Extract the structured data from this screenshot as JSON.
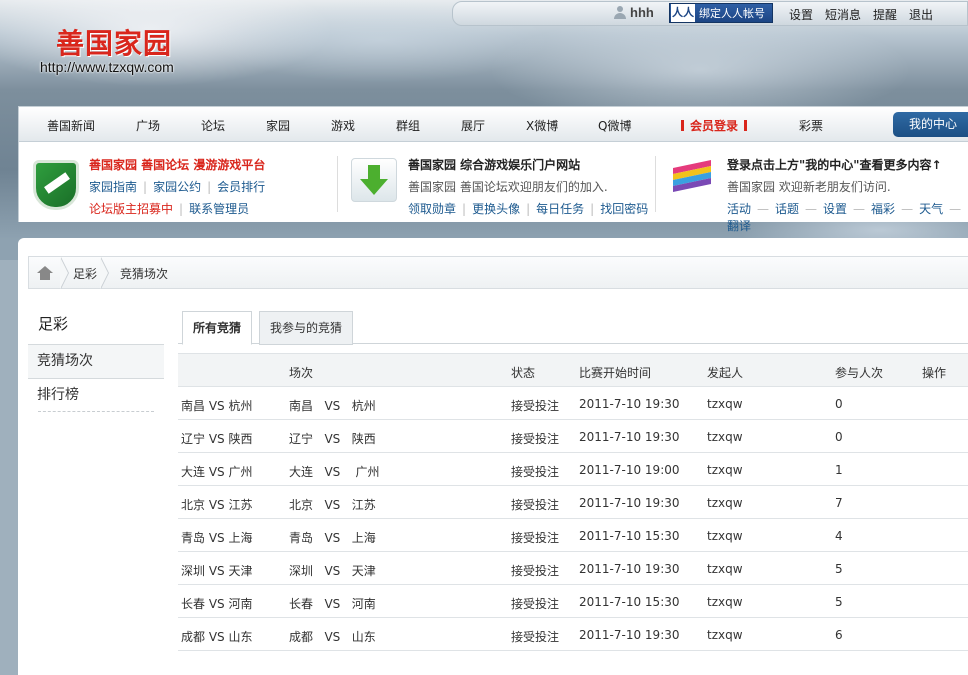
{
  "topbar": {
    "username": "hhh",
    "renren_logo": "人人",
    "renren_label": "绑定人人帐号",
    "links": [
      "设置",
      "短消息",
      "提醒",
      "退出"
    ]
  },
  "logo": {
    "title": "善国家园",
    "url": "http://www.tzxqw.com"
  },
  "nav": {
    "items": [
      "善国新闻",
      "广场",
      "论坛",
      "家园",
      "游戏",
      "群组",
      "展厅",
      "X微博",
      "Q微博"
    ],
    "member_login": "会员登录",
    "lottery": "彩票",
    "my_center": "我的中心"
  },
  "info": {
    "block1": {
      "title": "善国家园 善国论坛 漫游游戏平台",
      "links": [
        "家园指南",
        "家园公约",
        "会员排行"
      ],
      "recruit": "论坛版主招募中",
      "contact": "联系管理员"
    },
    "block2": {
      "title": "善国家园 综合游戏娱乐门户网站",
      "desc": "善国家园 善国论坛欢迎朋友们的加入.",
      "links": [
        "领取勋章",
        "更换头像",
        "每日任务",
        "找回密码"
      ]
    },
    "block3": {
      "title": "登录点击上方\"我的中心\"查看更多内容↑",
      "desc": "善国家园 欢迎新老朋友们访问.",
      "links": [
        "活动",
        "话题",
        "设置",
        "福彩",
        "天气",
        "翻译"
      ]
    }
  },
  "breadcrumb": [
    "足彩",
    "竞猜场次"
  ],
  "sidebar": {
    "title": "足彩",
    "items": [
      "竞猜场次",
      "排行榜"
    ]
  },
  "tabs": [
    "所有竞猜",
    "我参与的竞猜"
  ],
  "table": {
    "headers": [
      "场次",
      "状态",
      "比赛开始时间",
      "发起人",
      "参与人次",
      "操作"
    ],
    "rows": [
      {
        "title": "南昌 VS 杭州",
        "match": "南昌   VS   杭州",
        "status": "接受投注",
        "time": "2011-7-10 19:30",
        "creator": "tzxqw",
        "count": "0"
      },
      {
        "title": "辽宁 VS 陕西",
        "match": "辽宁   VS   陕西",
        "status": "接受投注",
        "time": "2011-7-10 19:30",
        "creator": "tzxqw",
        "count": "0"
      },
      {
        "title": "大连 VS 广州",
        "match": "大连   VS    广州",
        "status": "接受投注",
        "time": "2011-7-10 19:00",
        "creator": "tzxqw",
        "count": "1"
      },
      {
        "title": "北京 VS 江苏",
        "match": "北京   VS   江苏",
        "status": "接受投注",
        "time": "2011-7-10 19:30",
        "creator": "tzxqw",
        "count": "7"
      },
      {
        "title": "青岛 VS 上海",
        "match": "青岛   VS   上海",
        "status": "接受投注",
        "time": "2011-7-10 15:30",
        "creator": "tzxqw",
        "count": "4"
      },
      {
        "title": "深圳 VS 天津",
        "match": "深圳   VS   天津",
        "status": "接受投注",
        "time": "2011-7-10 19:30",
        "creator": "tzxqw",
        "count": "5"
      },
      {
        "title": "长春 VS 河南",
        "match": "长春   VS   河南",
        "status": "接受投注",
        "time": "2011-7-10 15:30",
        "creator": "tzxqw",
        "count": "5"
      },
      {
        "title": "成都 VS 山东",
        "match": "成都   VS   山东",
        "status": "接受投注",
        "time": "2011-7-10 19:30",
        "creator": "tzxqw",
        "count": "6"
      }
    ]
  }
}
